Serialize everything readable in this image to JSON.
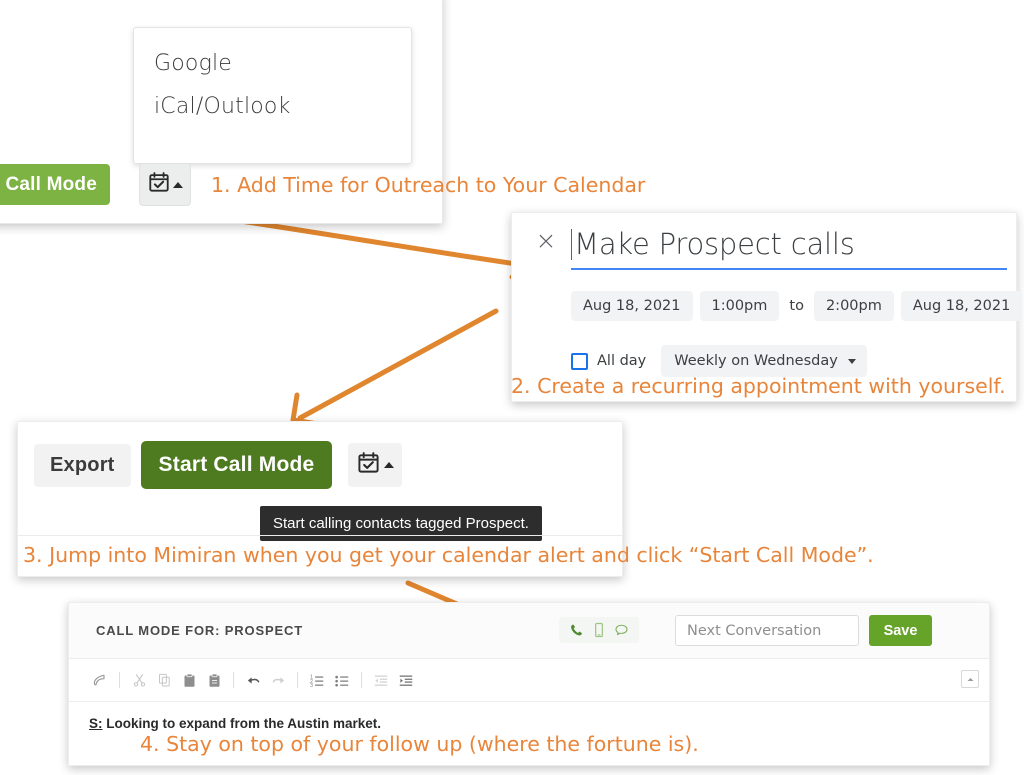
{
  "accent": {
    "annotation_orange": "#e8853a",
    "green_light": "#7cb342",
    "green_dark": "#4f7b20",
    "green_save": "#66a329",
    "google_blue": "#4285f4",
    "tooltip_bg": "#2d2d2d"
  },
  "calendar_button_panel": {
    "dropdown": {
      "items": [
        {
          "label": "Google",
          "name": "dropdown-item-google"
        },
        {
          "label": "iCal/Outlook",
          "name": "dropdown-item-ical-outlook"
        }
      ]
    },
    "call_mode_button_label": "Call Mode",
    "split_button_icon": "calendar-check-icon",
    "split_button_caret": "caret-up-icon"
  },
  "event_panel": {
    "close_label": "×",
    "title": "Make Prospect calls",
    "start_date": "Aug 18, 2021",
    "start_time": "1:00pm",
    "to_label": "to",
    "end_time": "2:00pm",
    "end_date": "Aug 18, 2021",
    "all_day_label": "All day",
    "recurrence": "Weekly on Wednesday"
  },
  "start_call_panel": {
    "export_label": "Export",
    "start_call_mode_label": "Start Call Mode",
    "tooltip": "Start calling contacts tagged Prospect.",
    "split_button_icon": "calendar-check-icon"
  },
  "call_mode_panel": {
    "header_title": "CALL MODE FOR: PROSPECT",
    "contact_icons": [
      {
        "name": "phone-icon",
        "glyph": "✆"
      },
      {
        "name": "mobile-icon",
        "glyph": "⎕"
      },
      {
        "name": "message-icon",
        "glyph": "◯"
      }
    ],
    "next_conversation_placeholder": "Next Conversation",
    "save_label": "Save",
    "editor_toolbar": [
      {
        "name": "source-edit-icon"
      },
      {
        "name": "cut-icon"
      },
      {
        "name": "copy-icon"
      },
      {
        "name": "paste-icon"
      },
      {
        "name": "paste-text-icon"
      },
      {
        "name": "undo-icon"
      },
      {
        "name": "redo-icon"
      },
      {
        "name": "numbered-list-icon"
      },
      {
        "name": "bulleted-list-icon"
      },
      {
        "name": "outdent-icon"
      },
      {
        "name": "indent-icon"
      }
    ],
    "collapse_icon": "collapse-toolbar-icon",
    "note_prefix": "S:",
    "note_text": " Looking to expand from the Austin market."
  },
  "annotations": [
    {
      "id": 1,
      "text": "1. Add Time for Outreach to Your Calendar"
    },
    {
      "id": 2,
      "text": "2. Create a recurring appointment with yourself."
    },
    {
      "id": 3,
      "text": "3. Jump into Mimiran when you get your calendar alert and click “Start Call Mode”."
    },
    {
      "id": 4,
      "text": "4. Stay on top of your follow up (where the fortune is)."
    }
  ]
}
